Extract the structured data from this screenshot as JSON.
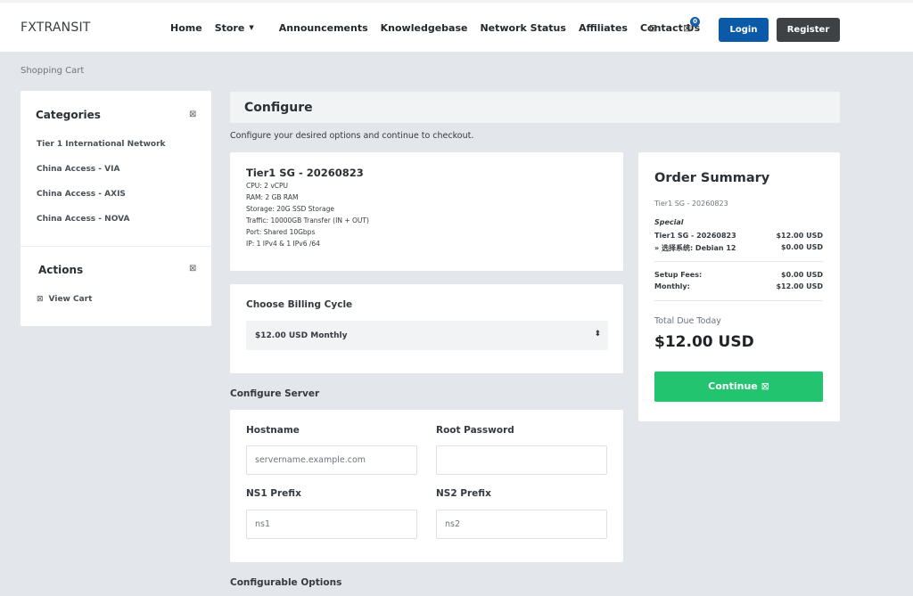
{
  "header": {
    "brand": "FXTRANSIT",
    "nav": [
      "Home",
      "Store",
      "Announcements",
      "Knowledgebase",
      "Network Status",
      "Affiliates",
      "Contact Us"
    ],
    "cart_count": "0",
    "login_label": "Login",
    "register_label": "Register"
  },
  "breadcrumb": "Shopping Cart",
  "sidebar": {
    "categories_title": "Categories",
    "categories": [
      "Tier 1 International Network",
      "China Access - VIA",
      "China Access - AXIS",
      "China Access - NOVA"
    ],
    "actions_title": "Actions",
    "view_cart": "View Cart"
  },
  "main": {
    "title": "Configure",
    "subtitle": "Configure your desired options and continue to checkout.",
    "product": {
      "name": "Tier1 SG - 20260823",
      "specs": [
        "CPU: 2 vCPU",
        "RAM: 2 GB RAM",
        "Storage: 20G SSD Storage",
        "Traffic: 10000GB Transfer (IN + OUT)",
        "Port: Shared 10Gbps",
        "IP: 1 IPv4 & 1 IPv6 /64"
      ]
    },
    "billing": {
      "label": "Choose Billing Cycle",
      "selected": "$12.00 USD Monthly"
    },
    "configure_server_heading": "Configure Server",
    "server": {
      "hostname_label": "Hostname",
      "hostname_placeholder": "servername.example.com",
      "root_password_label": "Root Password",
      "ns1_label": "NS1 Prefix",
      "ns1_placeholder": "ns1",
      "ns2_label": "NS2 Prefix",
      "ns2_placeholder": "ns2"
    },
    "configurable_options_heading": "Configurable Options"
  },
  "summary": {
    "title": "Order Summary",
    "product": "Tier1 SG - 20260823",
    "special": "Special",
    "lines": [
      {
        "label": "Tier1 SG - 20260823",
        "value": "$12.00 USD"
      },
      {
        "label": "» 选择系统: Debian 12",
        "value": "$0.00 USD"
      }
    ],
    "setup_fees_label": "Setup Fees:",
    "setup_fees_value": "$0.00 USD",
    "monthly_label": "Monthly:",
    "monthly_value": "$12.00 USD",
    "total_label": "Total Due Today",
    "total_value": "$12.00 USD",
    "continue_label": "Continue"
  },
  "colors": {
    "primary": "#0b5aa8",
    "success": "#22c46f",
    "dark_button": "#3e4245",
    "background": "#e3e6ea"
  }
}
